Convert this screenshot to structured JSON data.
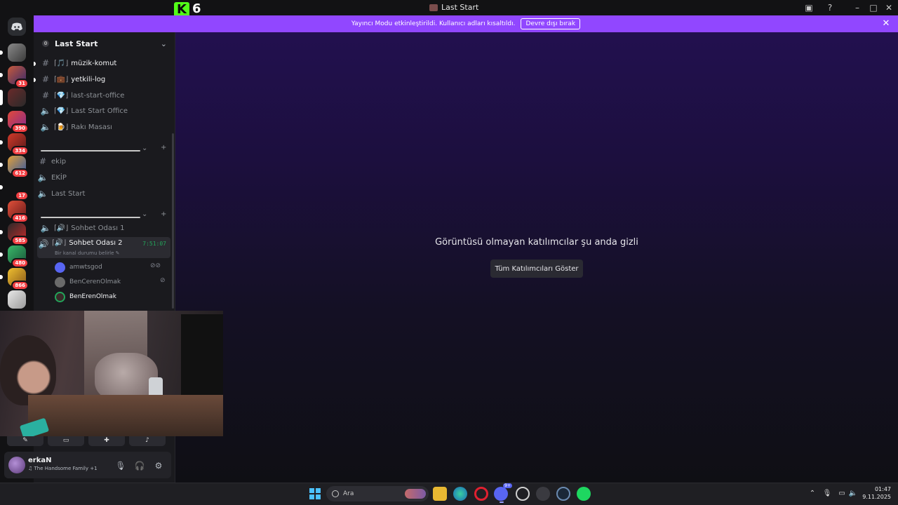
{
  "window": {
    "title": "Last Start"
  },
  "kick_overlay": {
    "count": "6"
  },
  "banner": {
    "text": "Yayıncı Modu etkinleştirildi. Kullanıcı adları kısaltıldı.",
    "button": "Devre dışı bırak"
  },
  "server_badges": [
    "31",
    "390",
    "334",
    "612",
    "17",
    "416",
    "585",
    "480",
    "866"
  ],
  "guild": {
    "name": "Last Start"
  },
  "channels_top": [
    {
      "label": "müzik-komut",
      "emoji": "🎵",
      "type": "text",
      "unread": true
    },
    {
      "label": "yetkili-log",
      "emoji": "💼",
      "type": "text",
      "unread": true
    },
    {
      "label": "last-start-office",
      "emoji": "💎",
      "type": "text",
      "unread": false
    },
    {
      "label": "Last Start Office",
      "emoji": "💎",
      "type": "voice",
      "unread": false
    },
    {
      "label": "Rakı Masası",
      "emoji": "🍺",
      "type": "voice",
      "unread": false
    }
  ],
  "channels_mid": [
    {
      "label": "ekip",
      "type": "text"
    },
    {
      "label": "EKİP",
      "type": "voice"
    },
    {
      "label": "Last Start",
      "type": "voice"
    }
  ],
  "voice_channels": [
    {
      "label": "Sohbet Odası 1",
      "emoji": "🔊"
    },
    {
      "label": "Sohbet Odası 2",
      "emoji": "🔊",
      "time": "7:51:07",
      "status": "Bir kanal durumu belirle"
    }
  ],
  "voice_users": [
    "amwtsgod",
    "BenCerenOlmak",
    "BenErenOlmak"
  ],
  "stage": {
    "message": "Görüntüsü olmayan katılımcılar şu anda gizli",
    "button": "Tüm Katılımcıları Göster"
  },
  "user": {
    "name": "erkaN",
    "status": "The Handsome Family +1"
  },
  "taskbar": {
    "search_placeholder": "Ara",
    "discord_badge": "9+"
  },
  "clock": {
    "time": "01:47",
    "date": "9.11.2025"
  },
  "colors": {
    "banner": "#9147ff",
    "kick": "#53fc18",
    "live_voice": "#23a55a",
    "badge": "#f23f43"
  }
}
